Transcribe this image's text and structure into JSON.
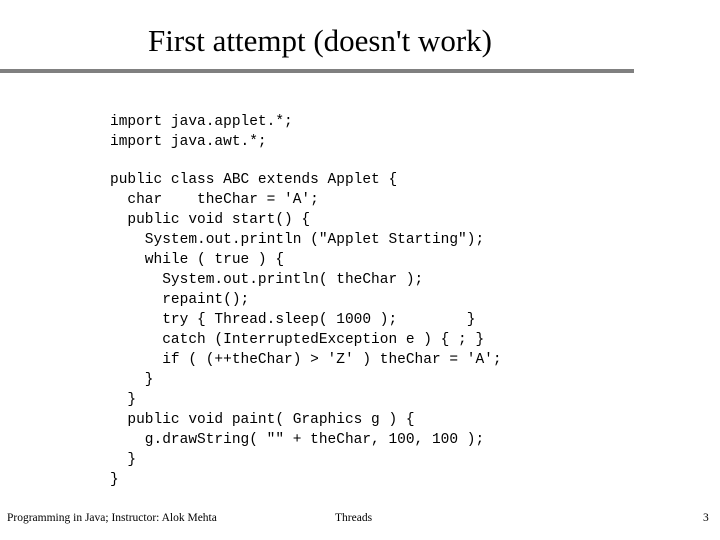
{
  "slide": {
    "title": "First attempt (doesn't work)",
    "rule_color": "#808080",
    "background_color": "#ffffff",
    "text_color": "#000000"
  },
  "code": {
    "language": "java",
    "lines": [
      "import java.applet.*;",
      "import java.awt.*;",
      "",
      "public class ABC extends Applet {",
      "  char    theChar = 'A';",
      "  public void start() {",
      "    System.out.println (\"Applet Starting\");",
      "    while ( true ) {",
      "      System.out.println( theChar );",
      "      repaint();",
      "      try { Thread.sleep( 1000 );        }",
      "      catch (InterruptedException e ) { ; }",
      "      if ( (++theChar) > 'Z' ) theChar = 'A';",
      "    }",
      "  }",
      "  public void paint( Graphics g ) {",
      "    g.drawString( \"\" + theChar, 100, 100 );",
      "  }",
      "}"
    ]
  },
  "footer": {
    "left": "Programming in Java; Instructor: Alok Mehta",
    "center": "Threads",
    "page_number": "3"
  }
}
